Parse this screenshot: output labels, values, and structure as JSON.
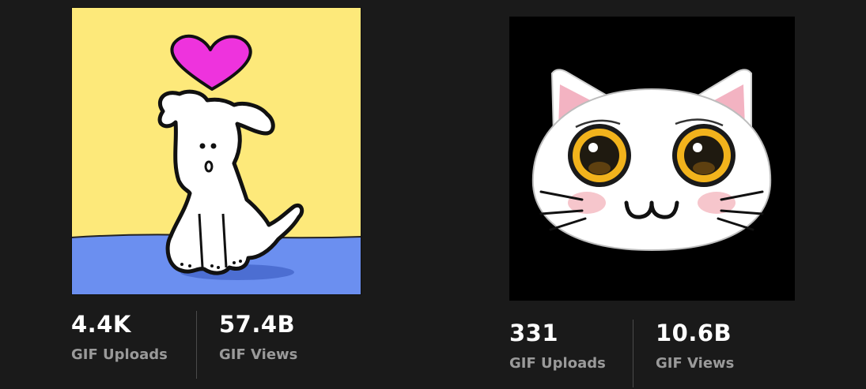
{
  "profiles": [
    {
      "avatar_icon": "dog-with-heart-icon",
      "uploads_value": "4.4K",
      "uploads_label": "GIF Uploads",
      "views_value": "57.4B",
      "views_label": "GIF Views"
    },
    {
      "avatar_icon": "white-cat-face-icon",
      "uploads_value": "331",
      "uploads_label": "GIF Uploads",
      "views_value": "10.6B",
      "views_label": "GIF Views"
    }
  ],
  "colors": {
    "background": "#1a1a1a",
    "stat_value": "#ffffff",
    "stat_label": "#9a9a9a",
    "dog_sky": "#fde97a",
    "dog_floor": "#6b8ff0",
    "heart": "#ee33dd",
    "cat_background": "#000000",
    "cat_eye": "#f2b31c",
    "cat_ear_inner": "#f3b3c2",
    "cat_blush": "#f6c6cc"
  }
}
